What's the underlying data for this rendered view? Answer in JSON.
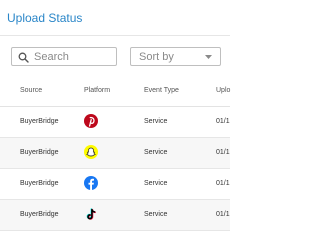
{
  "header": {
    "title": "Upload Status"
  },
  "search": {
    "placeholder": "Search",
    "value": ""
  },
  "sort": {
    "placeholder": "Sort by"
  },
  "table": {
    "columns": [
      "Source",
      "Platform",
      "Event Type",
      "Uplo"
    ],
    "rows": [
      {
        "source": "BuyerBridge",
        "platform_icon": "pinterest-icon",
        "event_type": "Service",
        "upload": "01/1"
      },
      {
        "source": "BuyerBridge",
        "platform_icon": "snapchat-icon",
        "event_type": "Service",
        "upload": "01/1"
      },
      {
        "source": "BuyerBridge",
        "platform_icon": "facebook-icon",
        "event_type": "Service",
        "upload": "01/1"
      },
      {
        "source": "BuyerBridge",
        "platform_icon": "tiktok-icon",
        "event_type": "Service",
        "upload": "01/1"
      }
    ]
  },
  "colors": {
    "title": "#2a86c8",
    "pinterest": "#bd081c",
    "snapchat": "#fffc00",
    "facebook": "#1877f2",
    "tiktok": "#000000"
  }
}
